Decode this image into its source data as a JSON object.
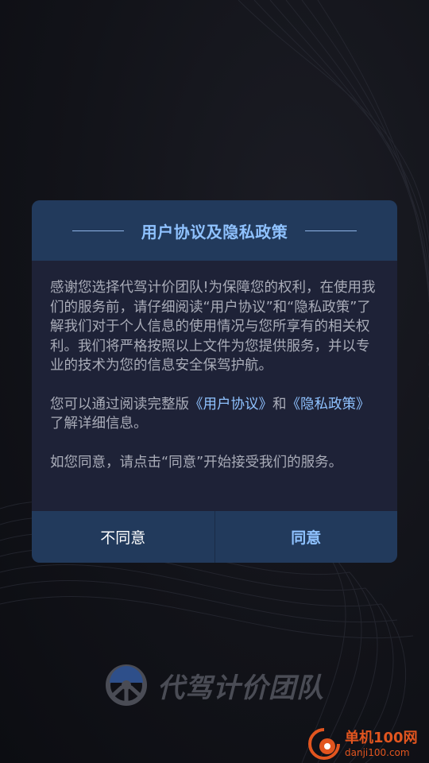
{
  "dialog": {
    "title": "用户协议及隐私政策",
    "paragraph1": "感谢您选择代驾计价团队!为保障您的权利，在使用我们的服务前，请仔细阅读“用户协议”和“隐私政策”了解我们对于个人信息的使用情况与您所享有的相关权利。我们将严格按照以上文件为您提供服务，并以专业的技术为您的信息安全保驾护航。",
    "paragraph2": {
      "prefix": "您可以通过阅读完整版",
      "user_agreement_link": "《用户协议》",
      "conjunction": "和",
      "privacy_policy_link": "《隐私政策》",
      "suffix": "了解详细信息。"
    },
    "paragraph3": "如您同意，请点击“同意”开始接受我们的服务。",
    "disagree_label": "不同意",
    "agree_label": "同意"
  },
  "brand": {
    "name": "代驾计价团队",
    "logo_icon": "steering-wheel-icon"
  },
  "watermark": {
    "name": "单机100网",
    "domain": "danji100.com",
    "logo_icon": "danji-logo-icon"
  },
  "colors": {
    "background": "#0f1016",
    "dialog": "#1e2237",
    "dialog_header": "#223a5c",
    "accent": "#8fc2ff",
    "body_text": "#a9acb8",
    "watermark": "#e2551f"
  }
}
